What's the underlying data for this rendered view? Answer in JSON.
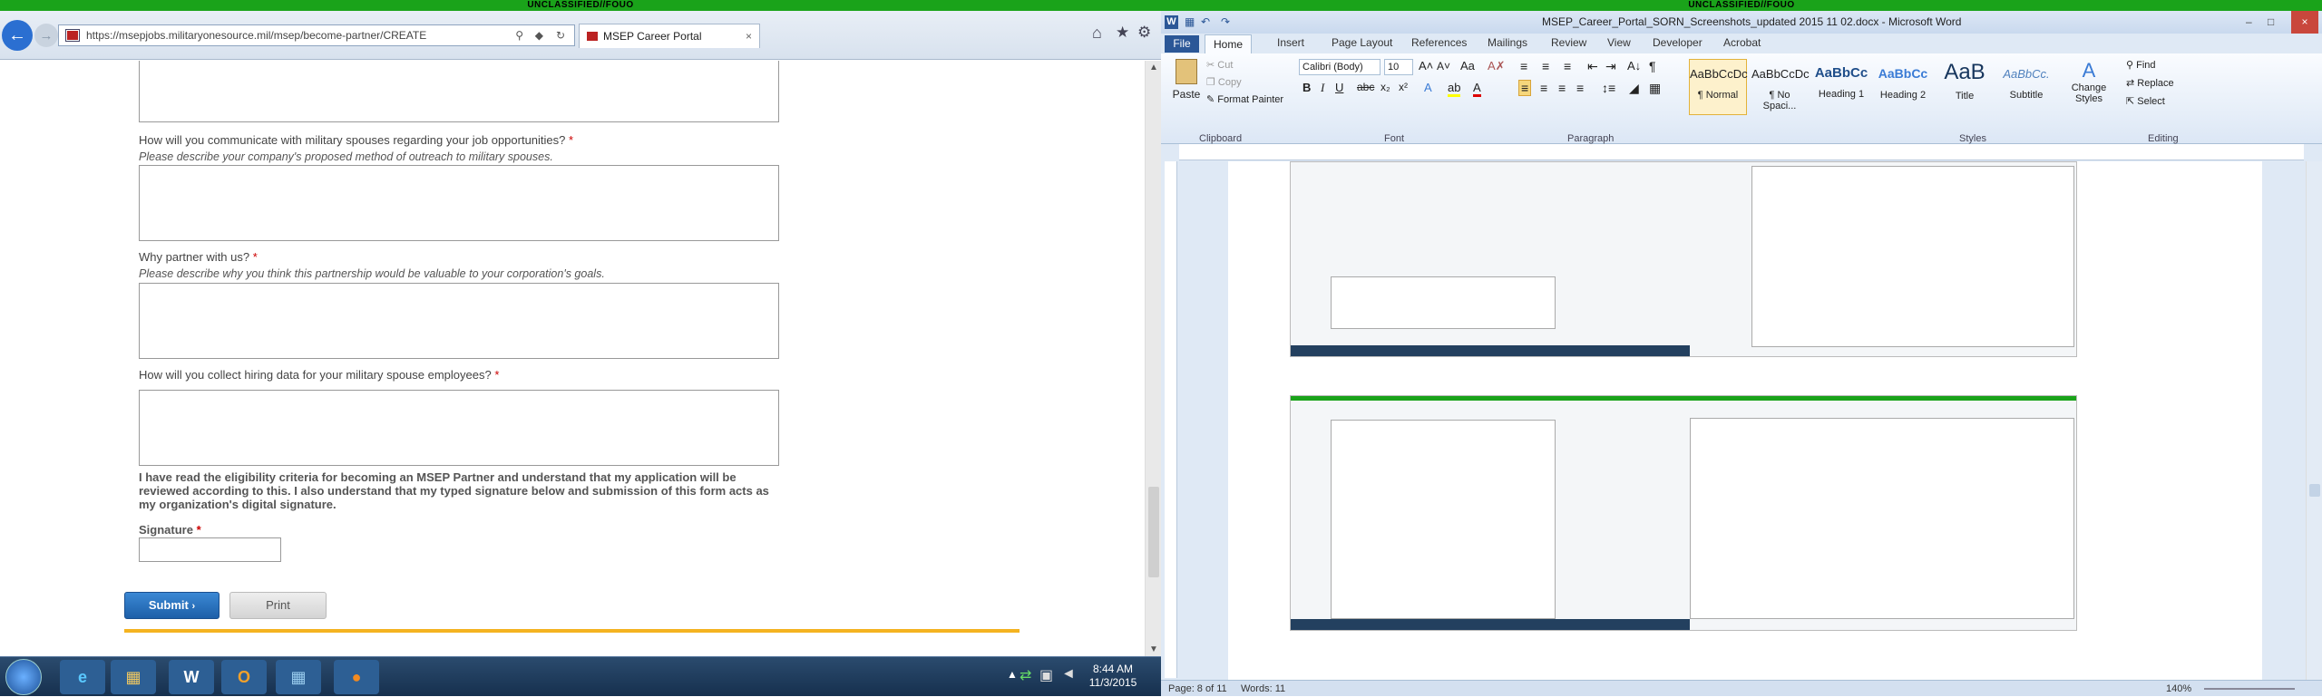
{
  "classification": "UNCLASSIFIED//FOUO",
  "ie": {
    "address": "https://msepjobs.militaryonesource.mil/msep/become-partner/CREATE",
    "tab_title": "MSEP Career Portal",
    "questions": [
      {
        "label": "How will you communicate with military spouses regarding your job opportunities?",
        "hint": "Please describe your company's proposed method of outreach to military spouses."
      },
      {
        "label": "Why partner with us?",
        "hint": "Please describe why you think this partnership would be valuable to your corporation's goals."
      },
      {
        "label": "How will you collect hiring data for your military spouse employees?",
        "hint": ""
      }
    ],
    "required_mark": "*",
    "agreement": "I have read the eligibility criteria for becoming an MSEP Partner and understand that my application will be reviewed according to this. I also understand that my typed signature below and submission of this form acts as my organization's digital signature.",
    "signature_label": "Signature",
    "submit_label": "Submit",
    "print_label": "Print"
  },
  "taskbar": {
    "time": "8:44 AM",
    "date": "11/3/2015"
  },
  "word": {
    "title": "MSEP_Career_Portal_SORN_Screenshots_updated 2015 11 02.docx - Microsoft Word",
    "tabs": [
      "File",
      "Home",
      "Insert",
      "Page Layout",
      "References",
      "Mailings",
      "Review",
      "View",
      "Developer",
      "Acrobat"
    ],
    "clipboard": {
      "paste": "Paste",
      "cut": "Cut",
      "copy": "Copy",
      "format_painter": "Format Painter",
      "group": "Clipboard"
    },
    "font": {
      "name": "Calibri (Body)",
      "size": "10",
      "group": "Font"
    },
    "paragraph_group": "Paragraph",
    "styles": [
      {
        "preview": "AaBbCcDc",
        "name": "¶ Normal"
      },
      {
        "preview": "AaBbCcDc",
        "name": "¶ No Spaci..."
      },
      {
        "preview": "AaBbCc",
        "name": "Heading 1"
      },
      {
        "preview": "AaBbCc",
        "name": "Heading 2"
      },
      {
        "preview": "AaB",
        "name": "Title"
      },
      {
        "preview": "AaBbCc.",
        "name": "Subtitle"
      }
    ],
    "change_styles": "Change Styles",
    "styles_group": "Styles",
    "editing": {
      "find": "Find",
      "replace": "Replace",
      "select": "Select",
      "group": "Editing"
    },
    "status_page": "Page: 8 of 11",
    "status_words": "Words: 11",
    "zoom": "140%"
  }
}
